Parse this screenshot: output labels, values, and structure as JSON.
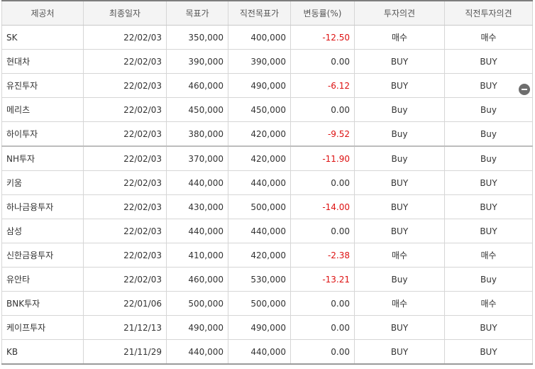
{
  "headers": [
    "제공처",
    "최종일자",
    "목표가",
    "직전목표가",
    "변동률(%)",
    "투자의견",
    "직전투자의견"
  ],
  "rows": [
    {
      "provider": "SK",
      "date": "22/02/03",
      "target": "350,000",
      "prev_target": "400,000",
      "change": "-12.50",
      "opinion": "매수",
      "prev_opinion": "매수"
    },
    {
      "provider": "현대차",
      "date": "22/02/03",
      "target": "390,000",
      "prev_target": "390,000",
      "change": "0.00",
      "opinion": "BUY",
      "prev_opinion": "BUY"
    },
    {
      "provider": "유진투자",
      "date": "22/02/03",
      "target": "460,000",
      "prev_target": "490,000",
      "change": "-6.12",
      "opinion": "BUY",
      "prev_opinion": "BUY"
    },
    {
      "provider": "메리츠",
      "date": "22/02/03",
      "target": "450,000",
      "prev_target": "450,000",
      "change": "0.00",
      "opinion": "Buy",
      "prev_opinion": "Buy"
    },
    {
      "provider": "하이투자",
      "date": "22/02/03",
      "target": "380,000",
      "prev_target": "420,000",
      "change": "-9.52",
      "opinion": "Buy",
      "prev_opinion": "Buy"
    },
    {
      "provider": "NH투자",
      "date": "22/02/03",
      "target": "370,000",
      "prev_target": "420,000",
      "change": "-11.90",
      "opinion": "Buy",
      "prev_opinion": "Buy"
    },
    {
      "provider": "키움",
      "date": "22/02/03",
      "target": "440,000",
      "prev_target": "440,000",
      "change": "0.00",
      "opinion": "BUY",
      "prev_opinion": "BUY"
    },
    {
      "provider": "하나금융투자",
      "date": "22/02/03",
      "target": "430,000",
      "prev_target": "500,000",
      "change": "-14.00",
      "opinion": "BUY",
      "prev_opinion": "BUY"
    },
    {
      "provider": "삼성",
      "date": "22/02/03",
      "target": "440,000",
      "prev_target": "440,000",
      "change": "0.00",
      "opinion": "BUY",
      "prev_opinion": "BUY"
    },
    {
      "provider": "신한금융투자",
      "date": "22/02/03",
      "target": "410,000",
      "prev_target": "420,000",
      "change": "-2.38",
      "opinion": "매수",
      "prev_opinion": "매수"
    },
    {
      "provider": "유안타",
      "date": "22/02/03",
      "target": "460,000",
      "prev_target": "530,000",
      "change": "-13.21",
      "opinion": "Buy",
      "prev_opinion": "Buy"
    },
    {
      "provider": "BNK투자",
      "date": "22/01/06",
      "target": "500,000",
      "prev_target": "500,000",
      "change": "0.00",
      "opinion": "매수",
      "prev_opinion": "매수"
    },
    {
      "provider": "케이프투자",
      "date": "21/12/13",
      "target": "490,000",
      "prev_target": "490,000",
      "change": "0.00",
      "opinion": "BUY",
      "prev_opinion": "BUY"
    },
    {
      "provider": "KB",
      "date": "21/11/29",
      "target": "440,000",
      "prev_target": "440,000",
      "change": "0.00",
      "opinion": "BUY",
      "prev_opinion": "BUY"
    }
  ],
  "colors": {
    "negative": "#dd1111",
    "header_bg": "#f4f4f4"
  },
  "icons": {
    "row_action": "minus-circle-icon"
  }
}
